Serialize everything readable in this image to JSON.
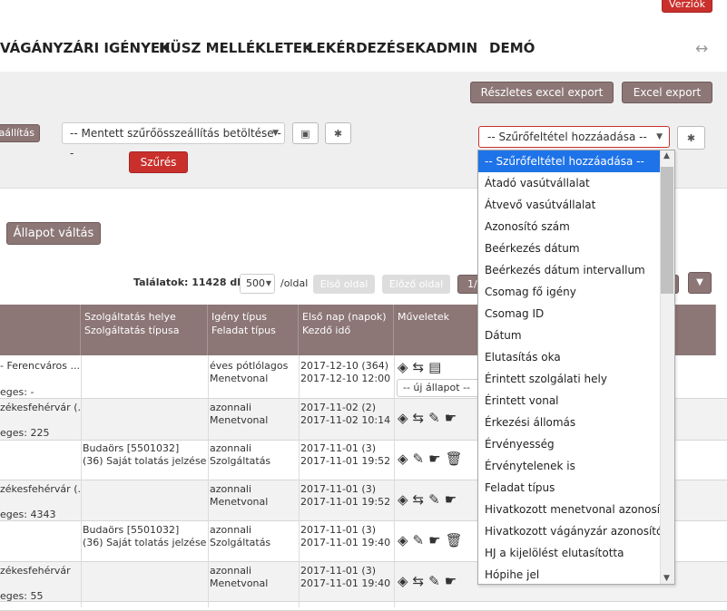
{
  "top": {
    "version_button": "Verziók",
    "expand_icon": "↔"
  },
  "nav": {
    "items": [
      "VÁGÁNYZÁRI IGÉNYEK",
      "HÜSZ MELLÉKLETEK",
      "LEKÉRDEZÉSEK",
      "ADMIN",
      "DEMÓ"
    ]
  },
  "export": {
    "detailed": "Részletes excel export",
    "excel": "Excel export"
  },
  "filters": {
    "left_button": "aállítás",
    "saved_filter": "-- Mentett szűrőösszeállítás betöltése --",
    "add_filter": "-- Szűrőfeltétel hozzáadása --",
    "filter_button": "Szűrés"
  },
  "state_change": "Állapot váltás",
  "pagination": {
    "results_label": "Találatok: 11428 db.",
    "per_page_value": "500",
    "per_page_label": "/oldal",
    "first_page": "Első oldal",
    "prev_page": "Előző oldal",
    "page_partial": "1/"
  },
  "table": {
    "headers": [
      {
        "line1": "Szolgáltatás helye",
        "line2": "Szolgáltatás típusa"
      },
      {
        "line1": "Igény típus",
        "line2": "Feladat típus"
      },
      {
        "line1": "Első nap (napok)",
        "line2": "Kezdő idő"
      },
      {
        "line1": "Műveletek",
        "line2": ""
      }
    ],
    "rows": [
      {
        "c0a": "- Ferencváros ...",
        "c0b": "eges: -",
        "c1a": "",
        "c1b": "",
        "c2a": "éves pótlólagos",
        "c2b": "Menetvonal",
        "c3a": "2017-12-10 (364)",
        "c3b": "2017-12-10 12:00",
        "state": "-- új állapot --"
      },
      {
        "c0a": "zékesfehérvár (...",
        "c0b": "eges: 225",
        "c1a": "",
        "c1b": "",
        "c2a": "azonnali",
        "c2b": "Menetvonal",
        "c3a": "2017-11-02 (2)",
        "c3b": "2017-11-02 10:14",
        "state": ""
      },
      {
        "c0a": "",
        "c0b": "",
        "c1a": "Budaörs [5501032]",
        "c1b": "(36) Saját tolatás jelzése",
        "c2a": "azonnali",
        "c2b": "Szolgáltatás",
        "c3a": "2017-11-01 (3)",
        "c3b": "2017-11-01 19:52",
        "state": ""
      },
      {
        "c0a": "zékesfehérvár (...",
        "c0b": "eges: 4343",
        "c1a": "",
        "c1b": "",
        "c2a": "azonnali",
        "c2b": "Menetvonal",
        "c3a": "2017-11-01 (3)",
        "c3b": "2017-11-01 19:52",
        "state": ""
      },
      {
        "c0a": "",
        "c0b": "",
        "c1a": "Budaörs [5501032]",
        "c1b": "(36) Saját tolatás jelzése",
        "c2a": "azonnali",
        "c2b": "Szolgáltatás",
        "c3a": "2017-11-01 (3)",
        "c3b": "2017-11-01 19:40",
        "state": ""
      },
      {
        "c0a": "zékesfehérvár",
        "c0b": "eges: 55",
        "c1a": "",
        "c1b": "",
        "c2a": "azonnali",
        "c2b": "Menetvonal",
        "c3a": "2017-11-01 (3)",
        "c3b": "2017-11-01 19:40",
        "state": ""
      }
    ]
  },
  "dropdown": {
    "options": [
      "-- Szűrőfeltétel hozzáadása --",
      "Átadó vasútvállalat",
      "Átvevő vasútvállalat",
      "Azonosító szám",
      "Beérkezés dátum",
      "Beérkezés dátum intervallum",
      "Csomag fő igény",
      "Csomag ID",
      "Dátum",
      "Elutasítás oka",
      "Érintett szolgálati hely",
      "Érintett vonal",
      "Érkezési állomás",
      "Érvényesség",
      "Érvénytelenek is",
      "Feladat típus",
      "Hivatkozott menetvonal azonosító",
      "Hivatkozott vágányzár azonosító",
      "HJ a kijelölést elutasította",
      "Hópihe jel"
    ]
  },
  "colors": {
    "accent": "#8c7676",
    "danger": "#c9302c",
    "selected": "#1e73e8"
  }
}
